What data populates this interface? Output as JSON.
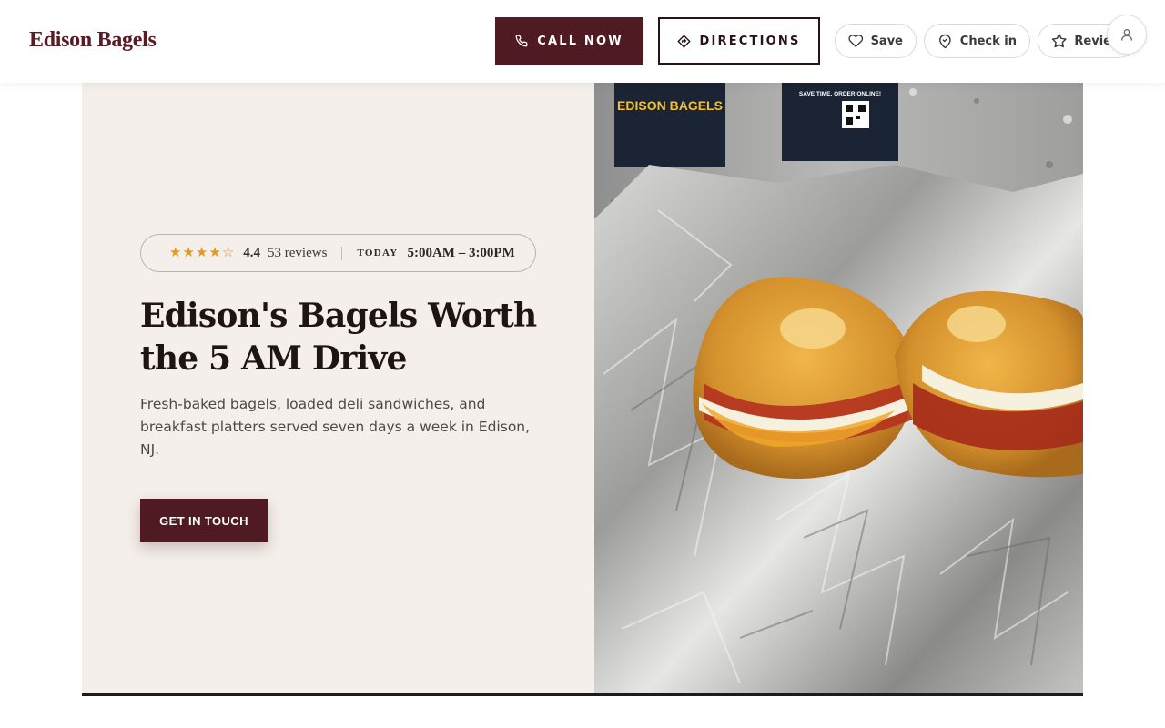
{
  "header": {
    "brand": "Edison Bagels",
    "call_label": "CALL NOW",
    "directions_label": "DIRECTIONS",
    "save_label": "Save",
    "checkin_label": "Check in",
    "review_label": "Review"
  },
  "hero": {
    "rating_value": "4.4",
    "stars_filled": 4,
    "stars_half": 1,
    "review_count": "53 reviews",
    "today_label": "TODAY",
    "hours": "5:00AM – 3:00PM",
    "title": "Edison's Bagels Worth the 5 AM Drive",
    "description": "Fresh-baked bagels, loaded deli sandwiches, and breakfast platters served seven days a week in Edison, NJ.",
    "cta_label": "GET IN TOUCH"
  },
  "photo": {
    "box_left_text": "EDISON BAGELS",
    "box_right_text": "SAVE TIME, ORDER ONLINE!"
  },
  "icons": {
    "call": "phone-icon",
    "directions": "directions-icon",
    "save": "heart-icon",
    "checkin": "location-pin-icon",
    "review": "star-icon",
    "account": "user-icon"
  },
  "colors": {
    "brand": "#5a1c22",
    "primary_button": "#4f1a22",
    "hero_background": "#f4efea",
    "star": "#e39a1b"
  }
}
